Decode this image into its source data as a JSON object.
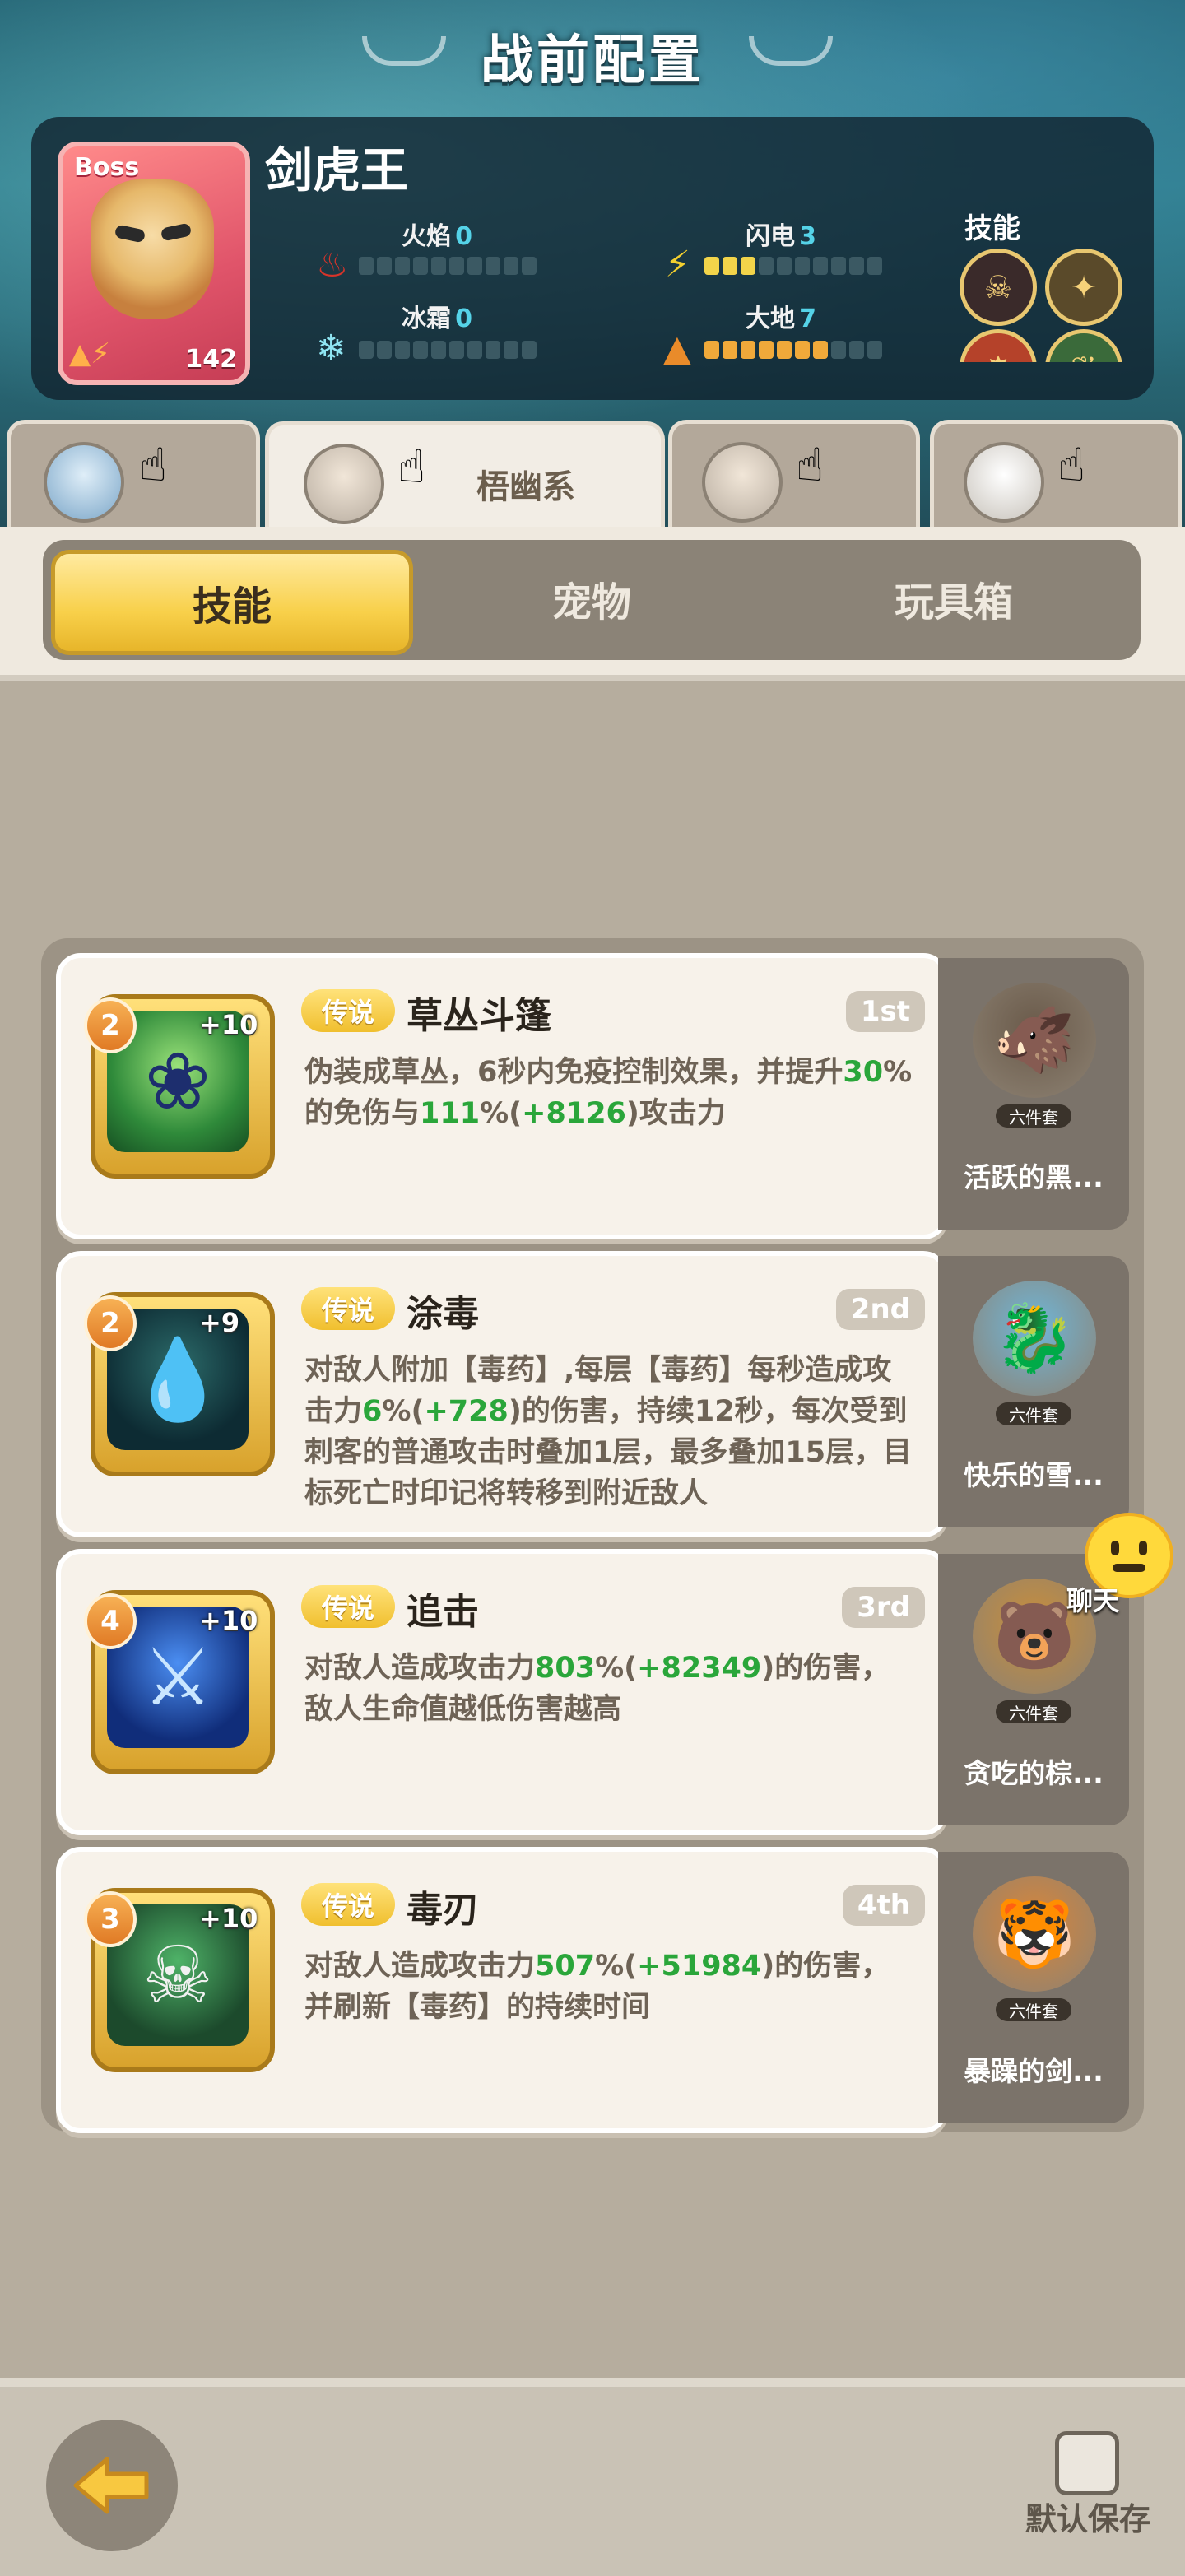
{
  "header": {
    "title": "战前配置"
  },
  "boss": {
    "tag": "Boss",
    "name": "剑虎王",
    "level": "142",
    "attributes": [
      {
        "label": "火焰",
        "value": "0",
        "filled": 0,
        "total": 10,
        "icon": "fire-icon"
      },
      {
        "label": "闪电",
        "value": "3",
        "filled": 3,
        "total": 10,
        "icon": "lightning-icon"
      },
      {
        "label": "冰霜",
        "value": "0",
        "filled": 0,
        "total": 10,
        "icon": "snowflake-icon"
      },
      {
        "label": "大地",
        "value": "7",
        "filled": 7,
        "total": 10,
        "icon": "earth-icon"
      }
    ],
    "skills_label": "技能"
  },
  "character_tabs": [
    {
      "name": "",
      "active": false
    },
    {
      "name": "梧幽系",
      "active": true
    },
    {
      "name": "",
      "active": false
    },
    {
      "name": "",
      "active": false
    }
  ],
  "segments": {
    "skill": "技能",
    "pet": "宠物",
    "toybox": "玩具箱",
    "active": "技能"
  },
  "skills": [
    {
      "level": "2",
      "plus": "+10",
      "rarity": "传说",
      "name": "草丛斗篷",
      "order": "1st",
      "desc": [
        "伪装成草丛，6秒内免疫控制效果，并提升",
        "30",
        "%的免伤与",
        "111",
        "%(",
        "+8126",
        ")攻击力"
      ],
      "icon": "bush-cloak-icon",
      "pet_name": "活跃的黑...",
      "pet_set": "六件套"
    },
    {
      "level": "2",
      "plus": "+9",
      "rarity": "传说",
      "name": "涂毒",
      "order": "2nd",
      "desc": [
        "对敌人附加【毒药】,每层【毒药】每秒造成攻击力",
        "6",
        "%(",
        "+728",
        ")的伤害，持续12秒，每次受到刺客的普通攻击时叠加1层，最多叠加15层，目标死亡时印记将转移到附近敌人"
      ],
      "icon": "poison-drop-icon",
      "pet_name": "快乐的雪...",
      "pet_set": "六件套"
    },
    {
      "level": "4",
      "plus": "+10",
      "rarity": "传说",
      "name": "追击",
      "order": "3rd",
      "desc": [
        "对敌人造成攻击力",
        "803",
        "%(",
        "+82349",
        ")的伤害，敌人生命值越低伤害越高"
      ],
      "icon": "pursuit-slash-icon",
      "pet_name": "贪吃的棕...",
      "pet_set": "六件套"
    },
    {
      "level": "3",
      "plus": "+10",
      "rarity": "传说",
      "name": "毒刃",
      "order": "4th",
      "desc": [
        "对敌人造成攻击力",
        "507",
        "%(",
        "+51984",
        ")的伤害，并刷新【毒药】的持续时间"
      ],
      "icon": "poison-skull-icon",
      "pet_name": "暴躁的剑...",
      "pet_set": "六件套"
    }
  ],
  "chat": {
    "label": "聊天"
  },
  "footer": {
    "save_label": "默认保存"
  }
}
